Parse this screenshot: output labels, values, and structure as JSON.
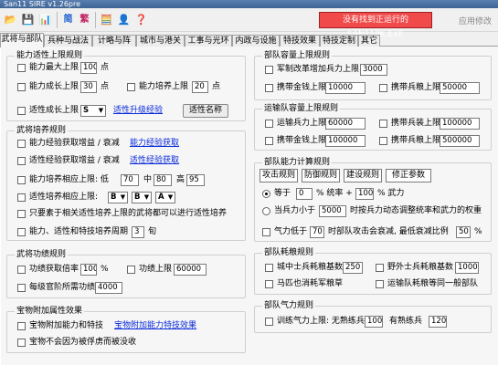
{
  "window": {
    "title": "San11 SIRE v1.26pre"
  },
  "toolbar": {
    "error_text": "没有找到正运行的SAN11PK.EXE",
    "apply_label": "应用修改",
    "icons": [
      "folder-icon",
      "save-icon",
      "chart-icon",
      "simplified-icon",
      "traditional-icon",
      "calculator-icon",
      "person-icon",
      "help-icon"
    ],
    "simplified_label": "简",
    "traditional_label": "繁"
  },
  "tabs": [
    "武将与部队",
    "兵种与战法",
    "计略与阵",
    "城市与港关",
    "工事与光环",
    "内政与设施",
    "特技效果",
    "特技定制",
    "其它"
  ],
  "groups": {
    "ability_limit": {
      "title": "能力适性上限规则",
      "max_label": "能力最大上限",
      "max_value": "100",
      "max_unit": "点",
      "growth_label": "能力成长上限",
      "growth_value": "30",
      "growth_unit": "点",
      "train_label": "能力培养上限",
      "train_value": "20",
      "train_unit": "点",
      "apt_label": "适性成长上限",
      "apt_value": "S",
      "apt_link": "适性升级经验",
      "apt_button": "适性名称"
    },
    "general_train": {
      "title": "武将培养规则",
      "exp_label": "能力经验获取增益 / 衰减",
      "exp_link": "能力经验获取",
      "apt_exp_label": "适性经验获取增益 / 衰减",
      "apt_exp_link": "适性经验获取",
      "train_range_label": "能力培养相应上限: 低",
      "low": "70",
      "mid_label": "中",
      "mid": "80",
      "high_label": "高",
      "high": "95",
      "apt_range_label": "适性培养相应上限:",
      "apt_b1": "B",
      "apt_b2": "B",
      "apt_a": "A",
      "req_label": "只要素于相关适性培养上限的武将都可以进行适性培养",
      "cycle_label": "能力、适性和特技培养周期",
      "cycle_value": "3",
      "cycle_unit": "旬"
    },
    "merit": {
      "title": "武将功绩规则",
      "rate_label": "功绩获取倍率",
      "rate_value": "100",
      "rate_unit": "%",
      "limit_label": "功绩上限",
      "limit_value": "60000",
      "official_label": "每级官阶所需功绩",
      "official_value": "4000"
    },
    "treasure": {
      "title": "宝物附加属性效果",
      "attach_label": "宝物附加能力和特技",
      "attach_link": "宝物附加能力特技效果",
      "lose_label": "宝物不会因为被俘虏而被没收"
    },
    "unit_cap": {
      "title": "部队容量上限规则",
      "title_label": "军制改革增加兵力上限",
      "title_value": "3000",
      "gold_label": "携带金钱上限",
      "gold_value": "10000",
      "food_label": "携带兵粮上限",
      "food_value": "50000"
    },
    "transport_cap": {
      "title": "运输队容量上限规则",
      "troop_label": "运输兵力上限",
      "troop_value": "60000",
      "weapon_label": "携带兵装上限",
      "weapon_value": "100000",
      "gold_label": "携带金钱上限",
      "gold_value": "100000",
      "food_label": "携带兵粮上限",
      "food_value": "500000"
    },
    "calc": {
      "title": "部队能力计算规则",
      "subtabs": [
        "攻击规则",
        "防御规则",
        "建设规则",
        "修正参数"
      ],
      "eq_label": "等于",
      "eq_v1": "0",
      "eq_t1": "% 统率 +",
      "eq_v2": "100",
      "eq_t2": "% 武力",
      "lt_label": "当兵力小于",
      "lt_value": "5000",
      "lt_text": "时按兵力动态调整统率和武力的权重",
      "morale_label": "气力低于",
      "morale_value": "70",
      "morale_text": "时部队攻击会衰减, 最低衰减比例",
      "morale_min": "50",
      "morale_unit": "%"
    },
    "consume": {
      "title": "部队耗粮规则",
      "city_label": "城中士兵耗粮基数",
      "city_value": "250",
      "field_label": "野外士兵耗粮基数",
      "field_value": "1000",
      "horse_label": "马匹也消耗军粮草",
      "transport_label": "运输队耗粮等同一般部队"
    },
    "spirit": {
      "title": "部队气力规则",
      "train_label": "训练气力上限:  无熟练兵",
      "train_value": "100",
      "skilled_label": "有熟练兵",
      "skilled_value": "120"
    }
  }
}
